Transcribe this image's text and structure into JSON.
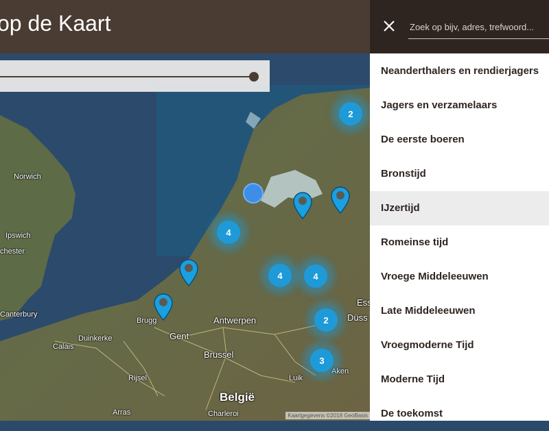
{
  "header": {
    "title": "op de Kaart"
  },
  "search": {
    "placeholder": "Zoek op bijv, adres, trefwoord..."
  },
  "eras": [
    {
      "label": "Neanderthalers en rendierjagers",
      "active": false
    },
    {
      "label": "Jagers en verzamelaars",
      "active": false
    },
    {
      "label": "De eerste boeren",
      "active": false
    },
    {
      "label": "Bronstijd",
      "active": false
    },
    {
      "label": "IJzertijd",
      "active": true
    },
    {
      "label": "Romeinse tijd",
      "active": false
    },
    {
      "label": "Vroege Middeleeuwen",
      "active": false
    },
    {
      "label": "Late Middeleeuwen",
      "active": false
    },
    {
      "label": "Vroegmoderne Tijd",
      "active": false
    },
    {
      "label": "Moderne Tijd",
      "active": false
    },
    {
      "label": "De toekomst",
      "active": false
    }
  ],
  "map": {
    "cities": {
      "norwich": "Norwich",
      "ipswich": "Ipswich",
      "chester": "chester",
      "canterbury": "Canterbury",
      "calais": "Calais",
      "duinkerke": "Duinkerke",
      "brugge": "Brugg",
      "gent": "Gent",
      "antwerpen": "Antwerpen",
      "brussel": "Brussel",
      "rijsel": "Rijsel",
      "arras": "Arras",
      "belgie": "België",
      "charleroi": "Charleroi",
      "luik": "Luik",
      "aken": "Aken",
      "essen": "Ess",
      "dusseldorf": "Düss"
    },
    "clusters": {
      "north": "2",
      "west": "4",
      "center": "4",
      "east": "4",
      "dusseldorf": "2",
      "luik": "3"
    },
    "attribution": "Kaartgegevens ©2018 GeoBasis"
  },
  "colors": {
    "header": "#4a3c33",
    "panel_header": "#2e2521",
    "cluster": "#1e9ad8",
    "active_item": "#ececec"
  }
}
